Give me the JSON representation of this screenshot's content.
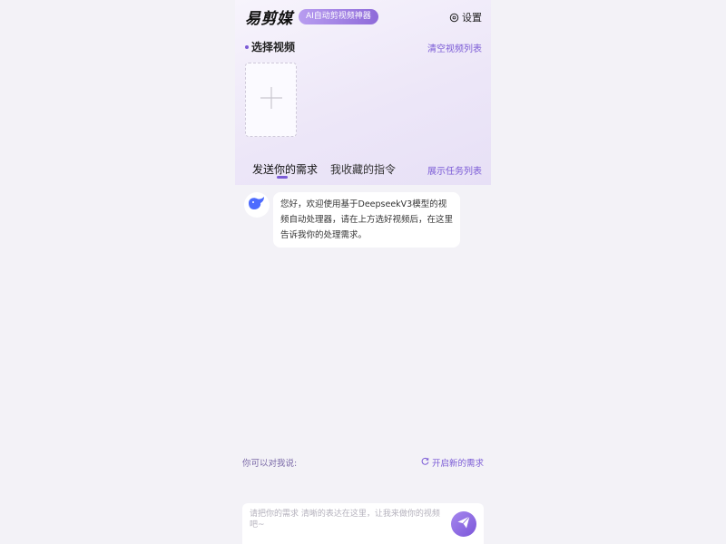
{
  "header": {
    "brand": "易剪媒",
    "tag": "AI自动剪视频神器",
    "settings_label": "设置"
  },
  "video_section": {
    "title": "选择视频",
    "clear_label": "清空视频列表"
  },
  "tabs": [
    {
      "label": "发送你的需求",
      "active": true
    },
    {
      "label": "我收藏的指令",
      "active": false
    }
  ],
  "task_list_label": "展示任务列表",
  "chat": {
    "messages": [
      {
        "from": "assistant",
        "text": "您好，欢迎使用基于DeepseekV3模型的视频自动处理器，请在上方选好视频后，在这里告诉我你的处理需求。"
      }
    ]
  },
  "hint": {
    "left": "你可以对我说:",
    "new_request_label": "开启新的需求"
  },
  "composer": {
    "placeholder": "请把你的需求 清晰的表达在这里，让我来做你的视频吧~",
    "value": ""
  },
  "colors": {
    "accent": "#7b5bd6",
    "background": "#f3f2f7"
  }
}
